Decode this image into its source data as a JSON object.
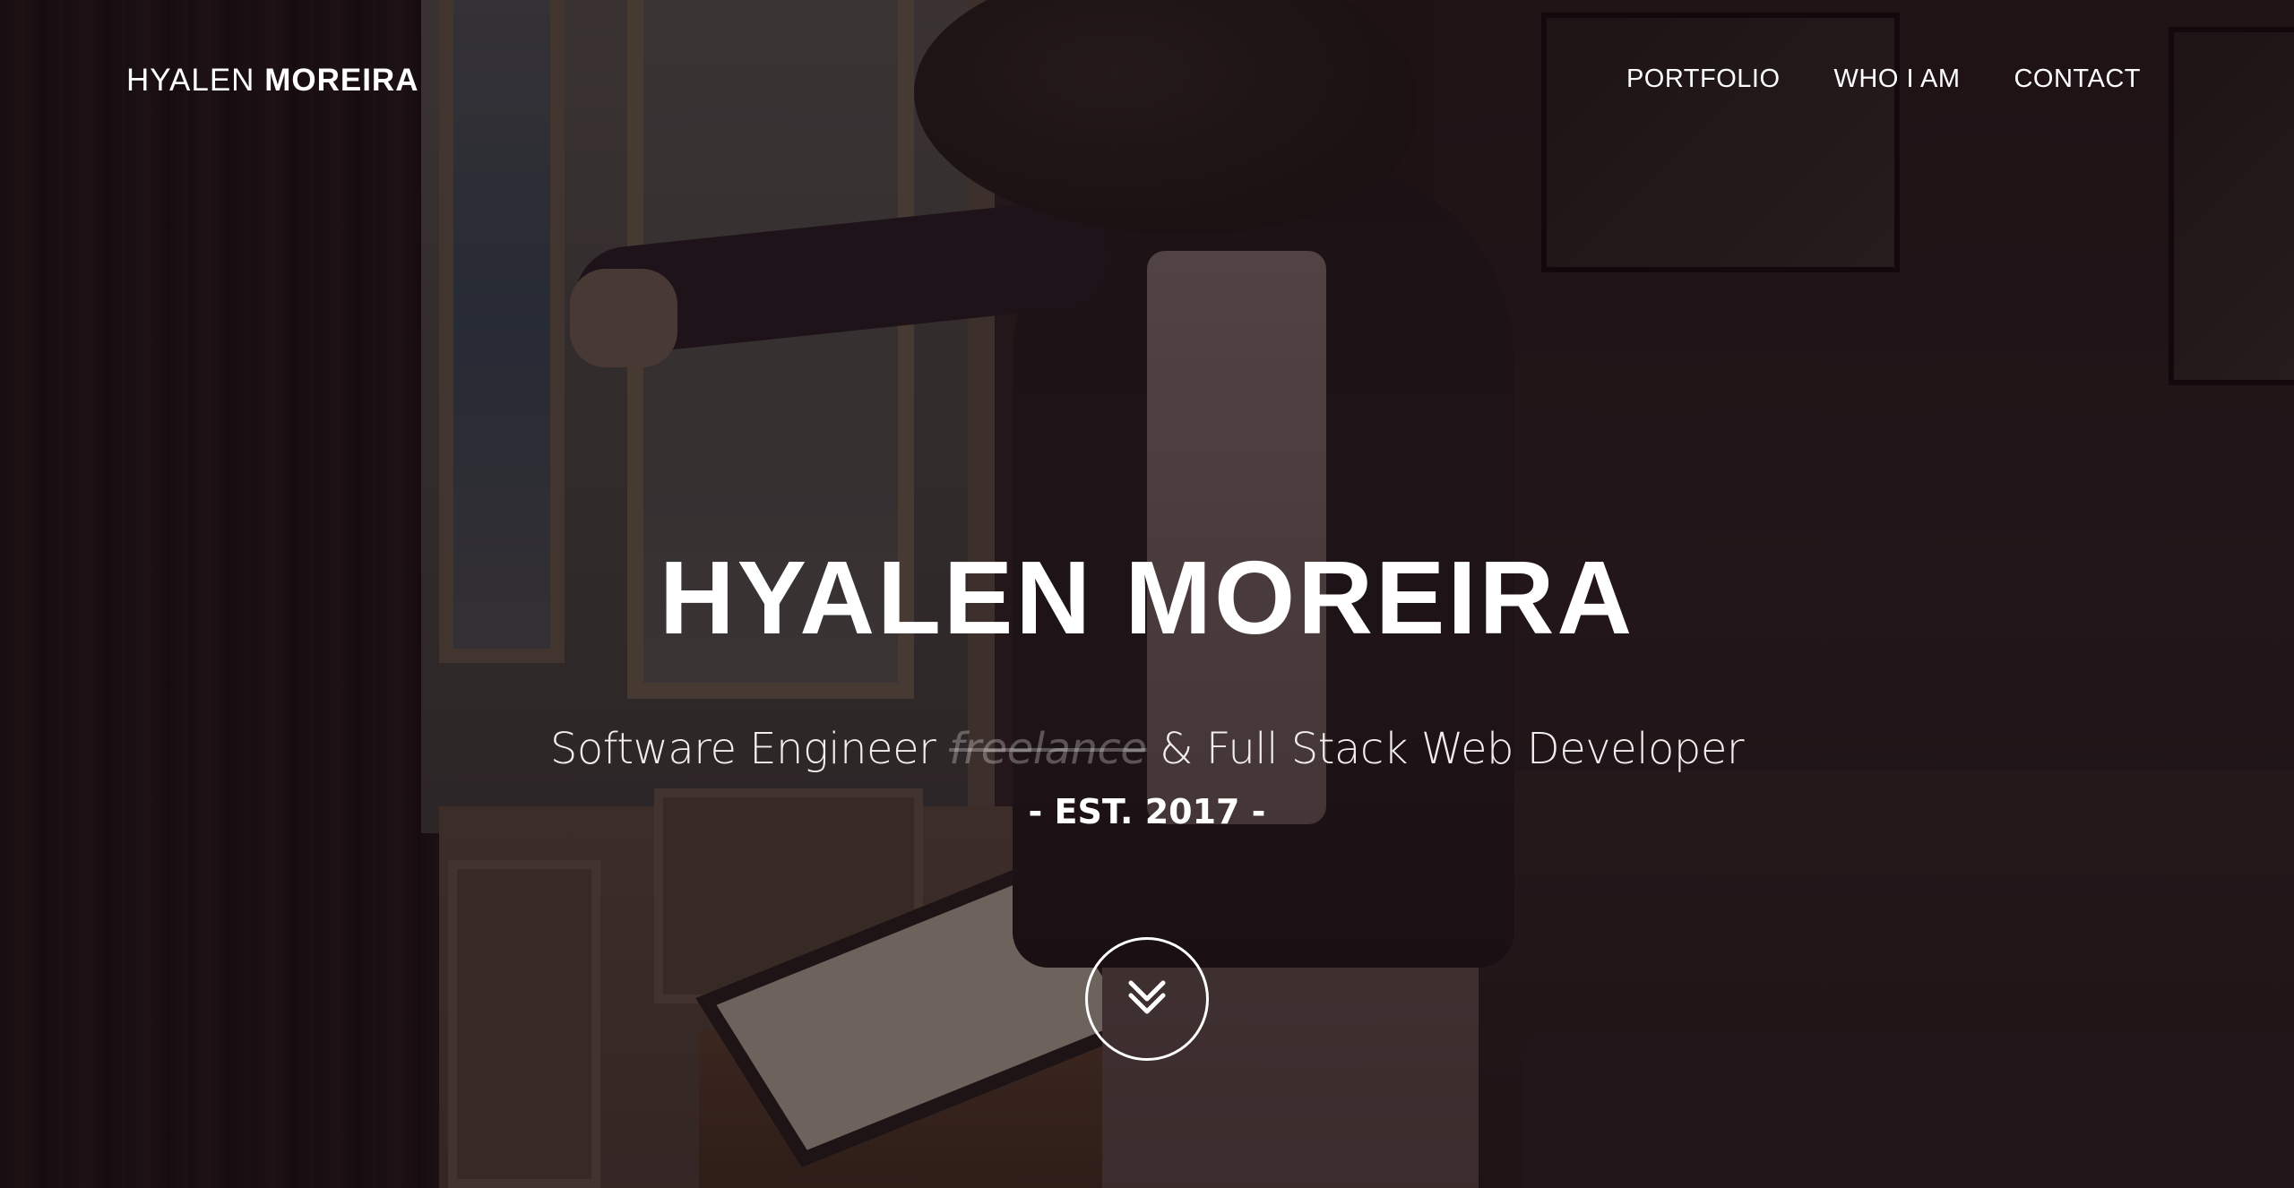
{
  "brand": {
    "first": "HYALEN",
    "last": "MOREIRA"
  },
  "nav": {
    "items": [
      {
        "label": "PORTFOLIO"
      },
      {
        "label": "WHO I AM"
      },
      {
        "label": "CONTACT"
      }
    ]
  },
  "hero": {
    "headline": "HYALEN MOREIRA",
    "tagline_start": "Software Engineer",
    "tagline_struck": "freelance",
    "tagline_end": "& Full Stack Web Developer",
    "established": "- EST. 2017 -",
    "scroll_icon": "double-chevron-down-icon"
  }
}
